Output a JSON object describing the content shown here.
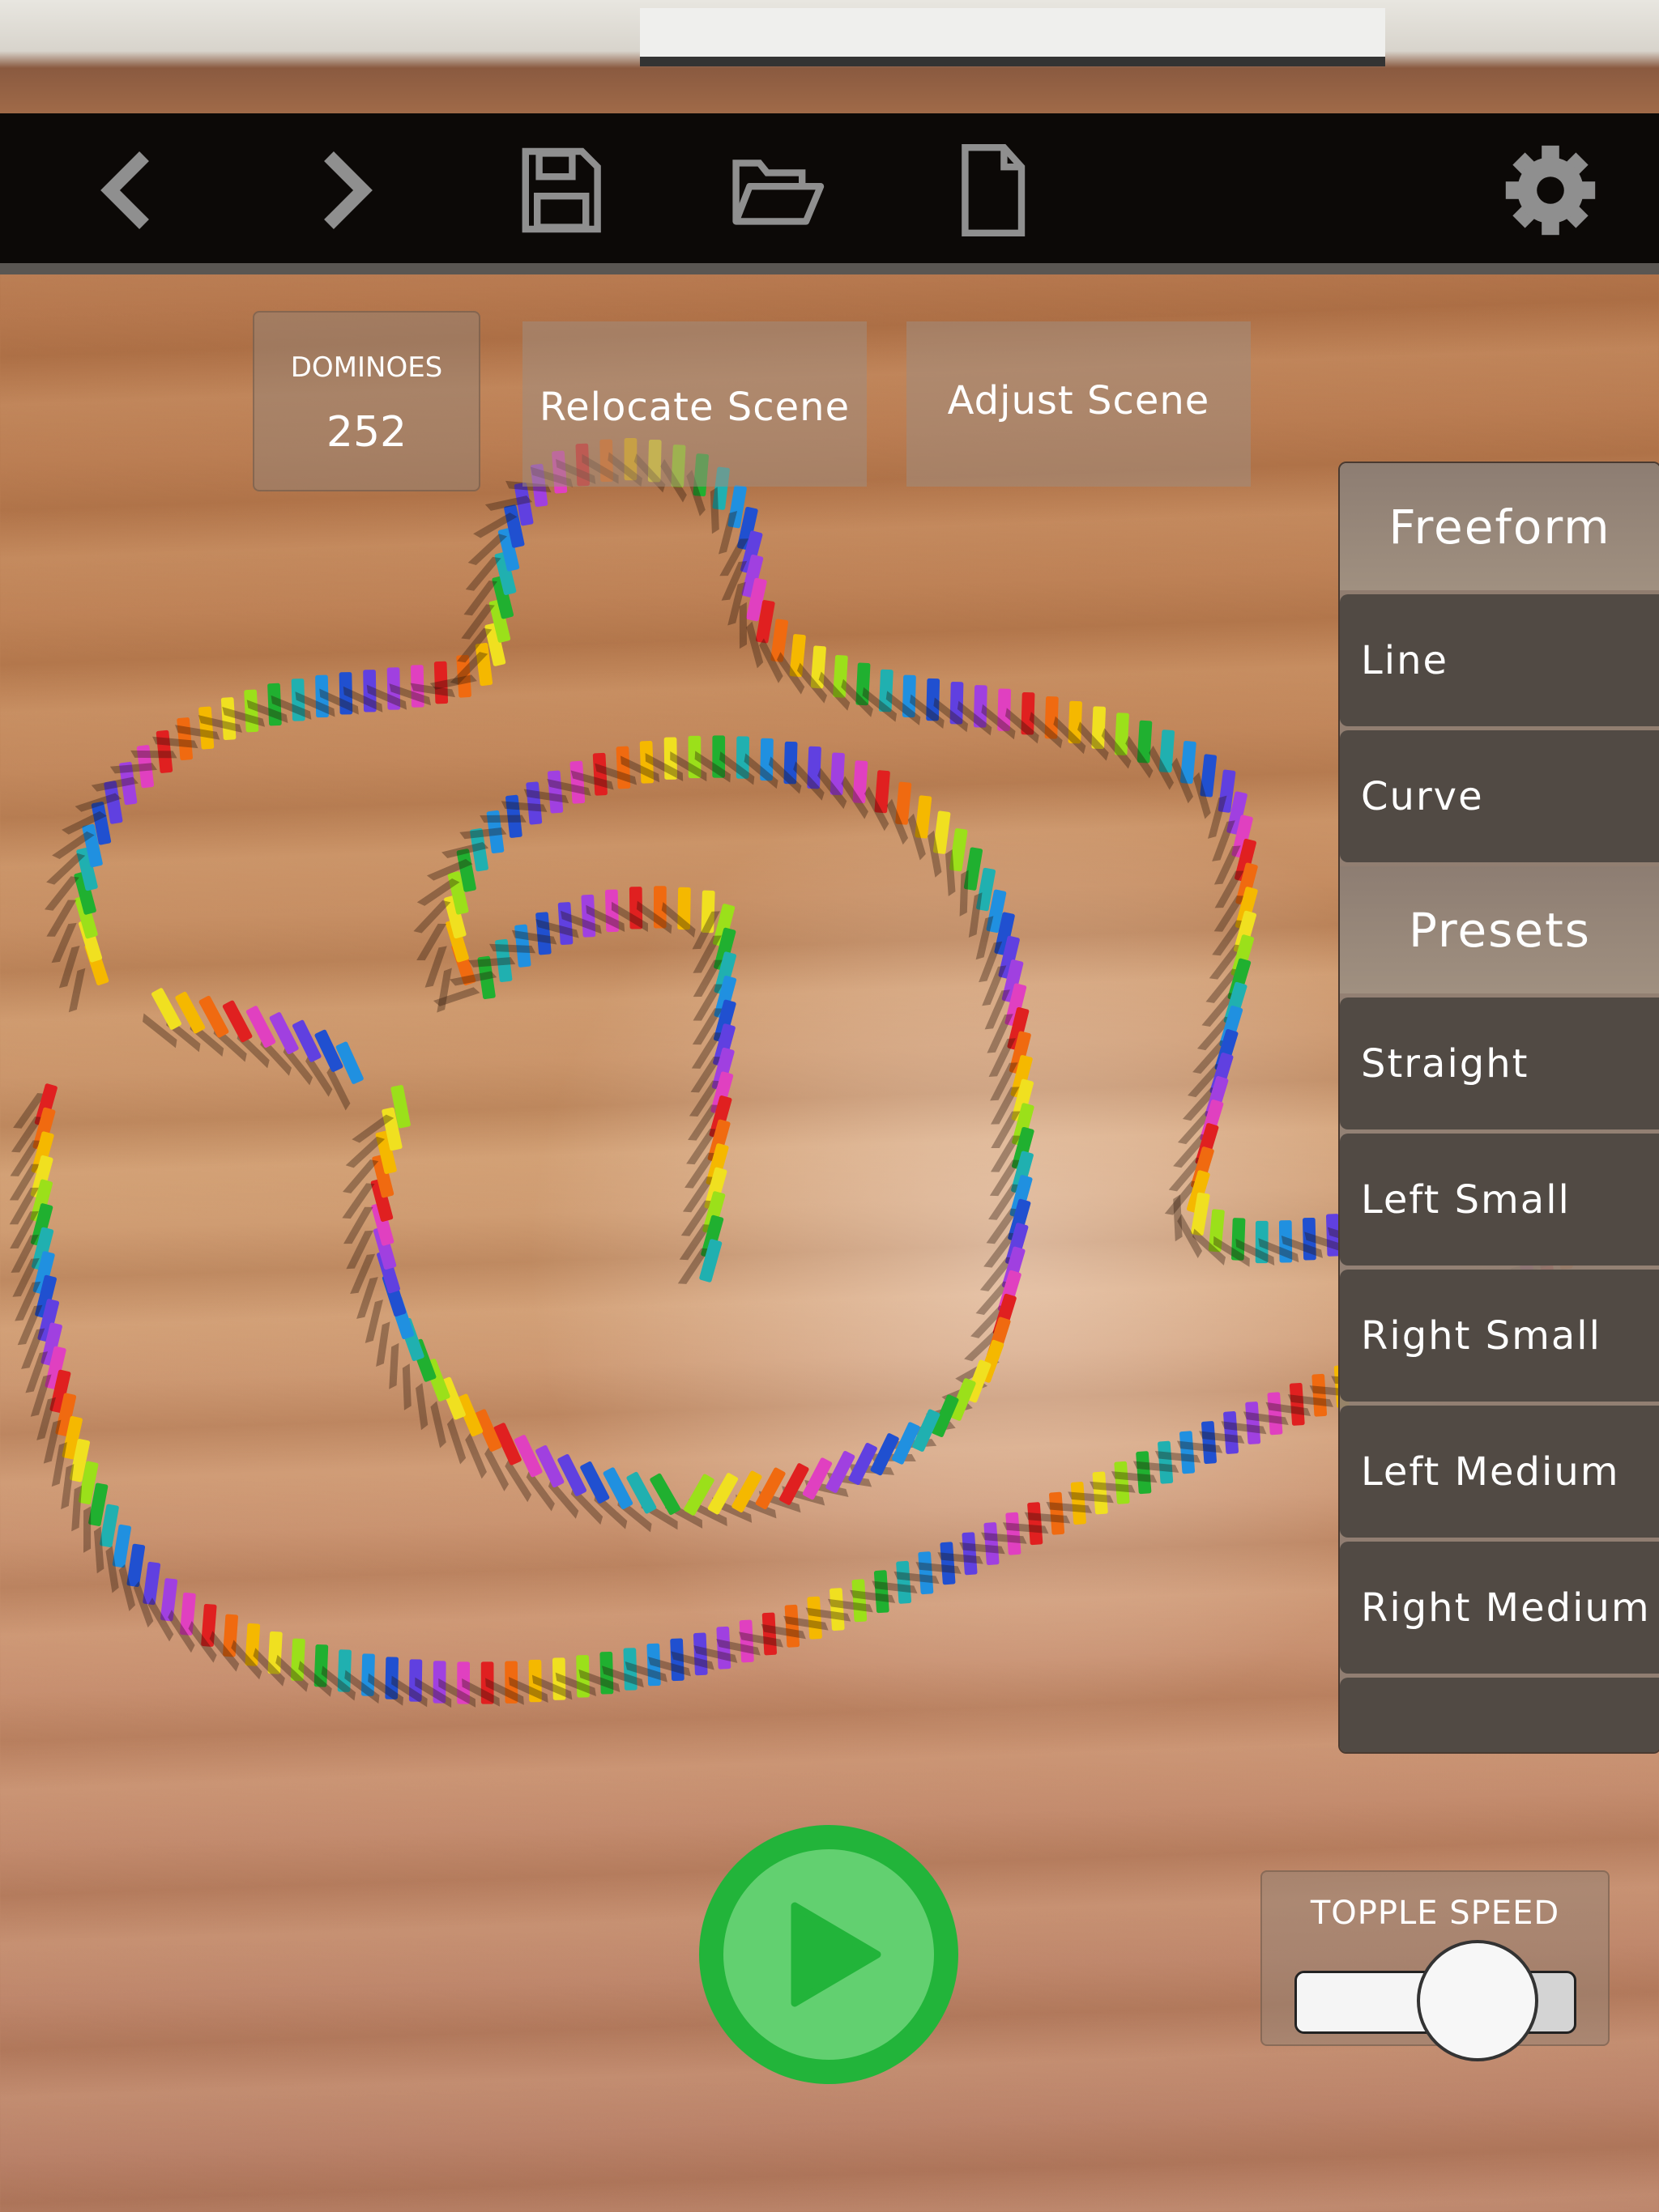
{
  "toolbar": {
    "icons": [
      "chevron-left-icon",
      "chevron-right-icon",
      "save-icon",
      "folder-open-icon",
      "new-file-icon",
      "gear-icon"
    ],
    "icon_color": "#8f8f8f"
  },
  "counter": {
    "label": "DOMINOES",
    "value": "252"
  },
  "scene_buttons": {
    "relocate": "Relocate Scene",
    "adjust": "Adjust Scene"
  },
  "side_menu": {
    "freeform_header": "Freeform",
    "freeform_items": [
      {
        "label": "Line"
      },
      {
        "label": "Curve"
      }
    ],
    "presets_header": "Presets",
    "preset_items": [
      {
        "label": "Straight"
      },
      {
        "label": "Left Small"
      },
      {
        "label": "Right Small"
      },
      {
        "label": "Left Medium"
      },
      {
        "label": "Right Medium"
      }
    ]
  },
  "play_button": {
    "icon": "play-icon",
    "color": "#22b43a"
  },
  "topple_speed": {
    "label": "TOPPLE SPEED",
    "value": 0.65
  },
  "domino_colors": [
    "#e02020",
    "#f06a10",
    "#f5b800",
    "#f0e020",
    "#9be01a",
    "#20b030",
    "#20b0b0",
    "#2090e0",
    "#2050d0",
    "#6040e0",
    "#a040e0",
    "#e040c0"
  ]
}
